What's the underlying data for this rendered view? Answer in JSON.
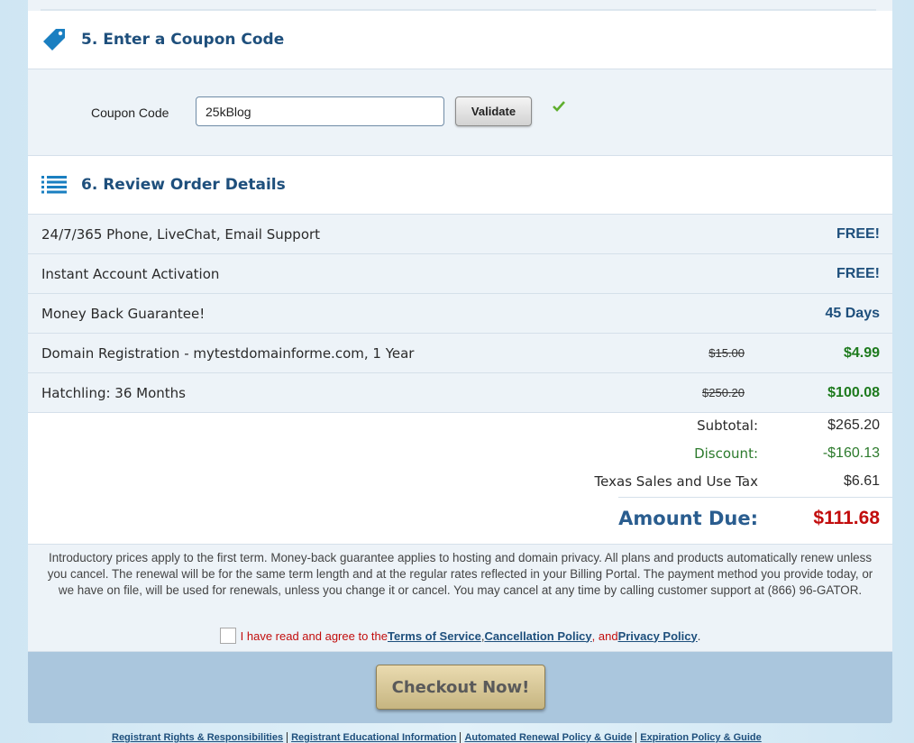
{
  "coupon_section": {
    "title": "5. Enter a Coupon Code",
    "field_label": "Coupon Code",
    "field_value": "25kBlog",
    "validate_label": "Validate"
  },
  "review_section": {
    "title": "6. Review Order Details",
    "items": [
      {
        "label": "24/7/365 Phone, LiveChat, Email Support",
        "original": "",
        "price": "FREE!"
      },
      {
        "label": "Instant Account Activation",
        "original": "",
        "price": "FREE!"
      },
      {
        "label": "Money Back Guarantee!",
        "original": "",
        "price": "45 Days"
      },
      {
        "label": "Domain Registration - mytestdomainforme.com, 1 Year",
        "original": "$15.00",
        "price": "$4.99"
      },
      {
        "label": "Hatchling: 36 Months",
        "original": "$250.20",
        "price": "$100.08"
      }
    ]
  },
  "totals": {
    "subtotal_label": "Subtotal:",
    "subtotal": "$265.20",
    "discount_label": "Discount:",
    "discount": "-$160.13",
    "tax_label": "Texas Sales and Use Tax",
    "tax": "$6.61",
    "amount_due_label": "Amount Due:",
    "amount_due": "$111.68"
  },
  "disclaimer": "Introductory prices apply to the first term. Money-back guarantee applies to hosting and domain privacy. All plans and products automatically renew unless you cancel. The renewal will be for the same term length and at the regular rates reflected in your Billing Portal. The payment method you provide today, or we have on file, will be used for renewals, unless you change it or cancel. You may cancel at any time by calling customer support at (866) 96-GATOR.",
  "agreement": {
    "prefix": "I have read and agree to the ",
    "tos": "Terms of Service",
    "comma": ", ",
    "cancellation": "Cancellation Policy",
    "and": ", and ",
    "privacy": "Privacy Policy",
    "period": "."
  },
  "checkout_label": "Checkout Now!",
  "footer_links": [
    "Registrant Rights & Responsibilities",
    "Registrant Educational Information",
    "Automated Renewal Policy & Guide",
    "Expiration Policy & Guide"
  ],
  "colors": {
    "heading": "#1e4f7c",
    "free": "#1e4f7c",
    "sale": "#1d7a1d",
    "amount_due": "#c20d0d",
    "check": "#5fae2e"
  }
}
